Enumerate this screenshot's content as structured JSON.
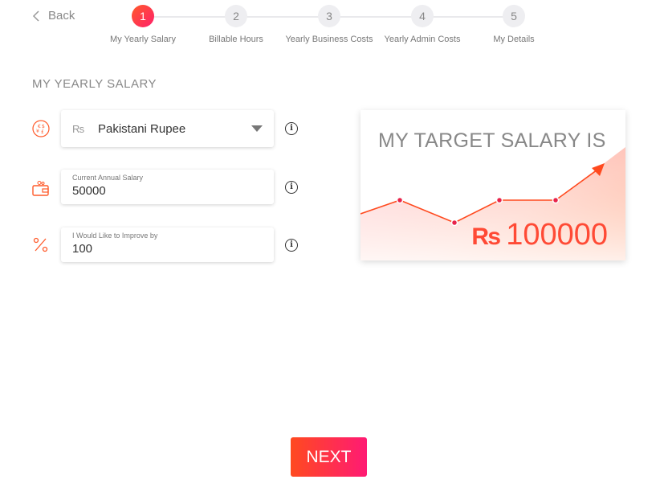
{
  "nav": {
    "back_label": "Back"
  },
  "steps": [
    {
      "number": "1",
      "label": "My Yearly Salary",
      "active": true
    },
    {
      "number": "2",
      "label": "Billable Hours",
      "active": false
    },
    {
      "number": "3",
      "label": "Yearly Business Costs",
      "active": false
    },
    {
      "number": "4",
      "label": "Yearly Admin Costs",
      "active": false
    },
    {
      "number": "5",
      "label": "My Details",
      "active": false
    }
  ],
  "section": {
    "title": "MY YEARLY SALARY"
  },
  "form": {
    "currency": {
      "symbol": "₨",
      "name": "Pakistani Rupee"
    },
    "current_salary": {
      "label": "Current Annual Salary",
      "value": "50000"
    },
    "improve_by": {
      "label": "I Would Like to Improve by",
      "value": "100"
    },
    "info_glyph": "i"
  },
  "target": {
    "title": "MY TARGET SALARY IS",
    "symbol": "₨",
    "amount": "100000"
  },
  "actions": {
    "next_label": "NEXT"
  },
  "colors": {
    "accent": "#ff4a35",
    "accent_gradient_end": "#ff1a74"
  },
  "icons": [
    "chevron-left-icon",
    "currency-exchange-icon",
    "wallet-icon",
    "percent-icon",
    "info-icon",
    "caret-down-icon"
  ]
}
